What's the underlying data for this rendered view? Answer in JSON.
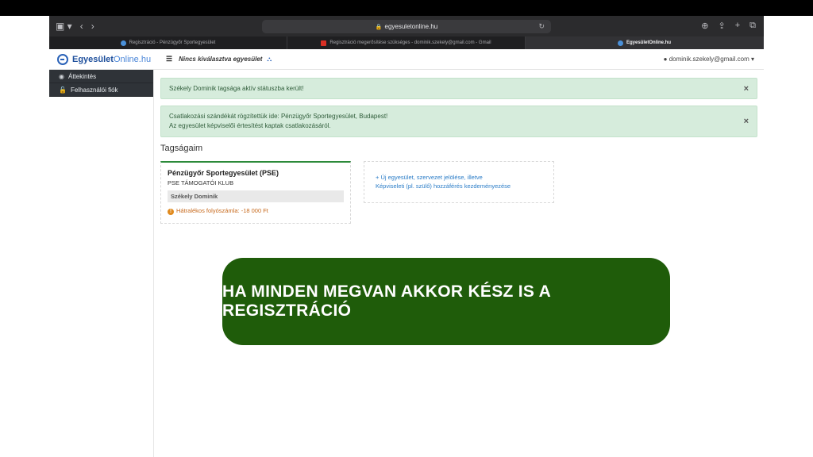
{
  "browser": {
    "url": "egyesuletonline.hu",
    "tabs": [
      {
        "label": "Regisztráció - Pénzügyőr Sportegyesület",
        "active": false
      },
      {
        "label": "Regisztráció megerősítése szükséges - dominik.szekely@gmail.com - Gmail",
        "active": false
      },
      {
        "label": "EgyesületOnline.hu",
        "active": true
      }
    ]
  },
  "app": {
    "logo_bold": "Egyesület",
    "logo_light": "Online.hu",
    "header_org": "Nincs kiválasztva egyesület",
    "user_email": "dominik.szekely@gmail.com"
  },
  "sidebar": {
    "items": [
      {
        "label": "Áttekintés",
        "icon": "dashboard-icon"
      },
      {
        "label": "Felhasználói fiók",
        "icon": "lock-icon"
      }
    ]
  },
  "alerts": [
    {
      "lines": [
        "Székely Dominik tagsága aktív státuszba került!"
      ]
    },
    {
      "lines": [
        "Csatlakozási szándékát rögzítettük ide: Pénzügyőr Sportegyesület, Budapest!",
        "Az egyesület képviselői értesítést kaptak csatlakozásáról."
      ]
    }
  ],
  "section_title": "Tagságaim",
  "membership": {
    "name": "Pénzügyőr Sportegyesület (PSE)",
    "club": "PSE TÁMOGATÓI KLUB",
    "member": "Székely Dominik",
    "debt": "Hátralékos folyószámla: -18 000 Ft"
  },
  "new_link": {
    "line1": "+ Új egyesület, szervezet jelölése, illetve",
    "line2": "Képviseleti (pl. szülő) hozzáférés kezdeményezése"
  },
  "banner": "HA MINDEN MEGVAN AKKOR KÉSZ IS A REGISZTRÁCIÓ",
  "colors": {
    "banner_bg": "#1f5c0a",
    "alert_bg": "#d6ecdc",
    "accent_blue": "#2a62b8",
    "card_top": "#2c8a3a",
    "debt_orange": "#c7691c"
  }
}
